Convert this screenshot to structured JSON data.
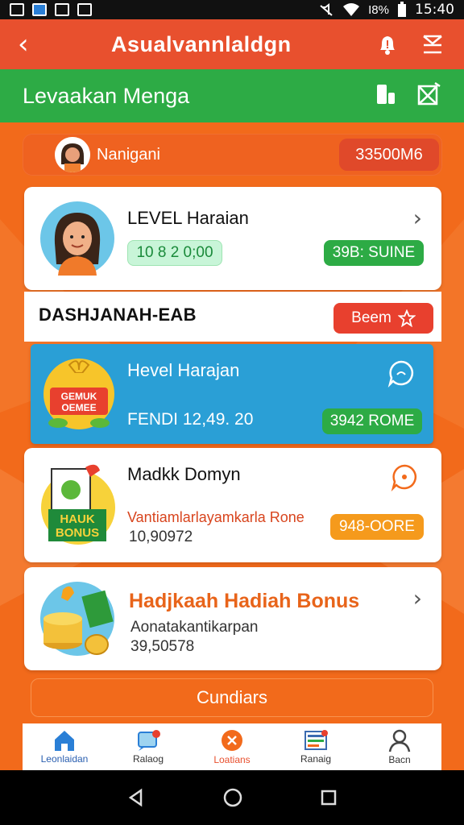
{
  "status_bar": {
    "time": "15:40",
    "battery": "I8%"
  },
  "header": {
    "title": "Asualvannlaldgn"
  },
  "sub_header": {
    "title": "Levaakan Menga"
  },
  "user": {
    "name": "Nanigani",
    "balance": "33500M6"
  },
  "level_card": {
    "title": "LEVEL Haraian",
    "progress": "10 8 2 0;00",
    "badge": "39B: SUINE"
  },
  "section": {
    "title": "DASHJANAH-EAB",
    "badge": "Beem"
  },
  "rewards": [
    {
      "title": "Hevel Harajan",
      "subtitle": "FENDI 12,49. 20",
      "badge": "3942 ROME",
      "image_text": [
        "GEMUK",
        "OEMEE"
      ]
    },
    {
      "title": "Madkk Domyn",
      "subtitle": "Vantiamlarlayamkarla Rone",
      "value": "10,90972",
      "badge": "948-OORE",
      "image_text": [
        "HAUK",
        "BONUS"
      ]
    },
    {
      "title": "Hadjkaah Hadiah Bonus",
      "subtitle": "Aonatakantikarpan",
      "value": "39,50578"
    }
  ],
  "cta": {
    "label": "Cundiars"
  },
  "bottom_nav": [
    {
      "label": "Leonlaidan",
      "icon": "home-icon"
    },
    {
      "label": "Ralaog",
      "icon": "chat-icon"
    },
    {
      "label": "Loatians",
      "icon": "close-circle-icon"
    },
    {
      "label": "Ranaig",
      "icon": "list-icon"
    },
    {
      "label": "Bacn",
      "icon": "user-icon"
    }
  ],
  "colors": {
    "header": "#e8502e",
    "sub_header": "#2dab45",
    "background": "#f26a1b",
    "highlight": "#2a9fd6"
  }
}
